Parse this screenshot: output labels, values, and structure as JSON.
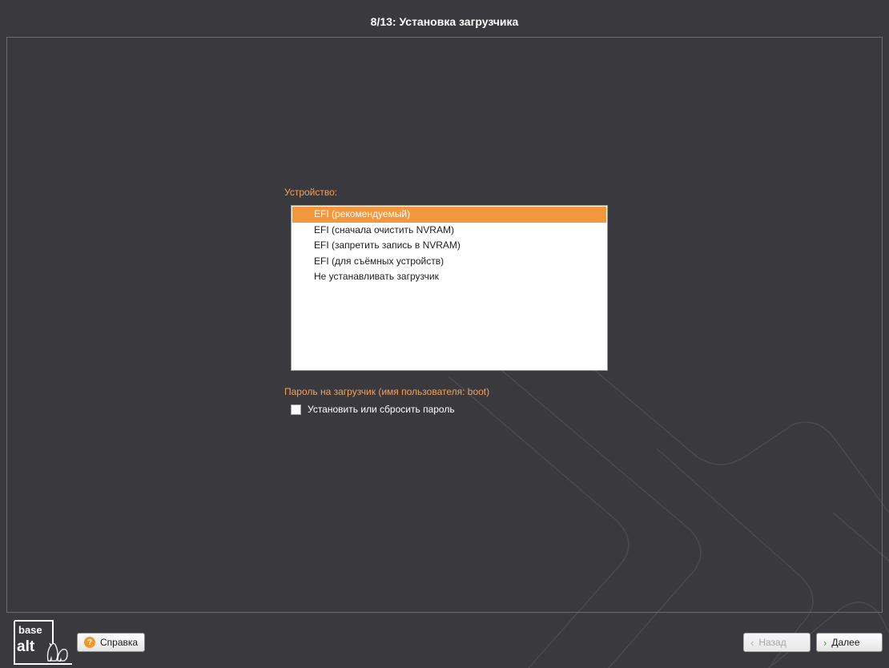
{
  "window": {
    "title": "8/13: Установка загрузчика"
  },
  "device_section": {
    "label": "Устройство:",
    "items": [
      {
        "label": "EFI (рекомендуемый)",
        "selected": true
      },
      {
        "label": "EFI (сначала очистить NVRAM)",
        "selected": false
      },
      {
        "label": "EFI (запретить запись в NVRAM)",
        "selected": false
      },
      {
        "label": "EFI (для съёмных устройств)",
        "selected": false
      },
      {
        "label": "Не устанавливать загрузчик",
        "selected": false
      }
    ]
  },
  "password_section": {
    "label": "Пароль на загрузчик (имя пользователя: boot)",
    "checkbox_label": "Установить или сбросить пароль",
    "checked": false
  },
  "logo": {
    "line1": "base",
    "line2": "alt"
  },
  "footer": {
    "help_label": "Справка",
    "back_label": "Назад",
    "next_label": "Далее"
  },
  "colors": {
    "background": "#3a393e",
    "accent": "#f3973f",
    "label": "#f2a15b"
  },
  "icons": {
    "help": "help-circle-icon",
    "back": "chevron-left-icon",
    "next": "chevron-right-icon"
  }
}
